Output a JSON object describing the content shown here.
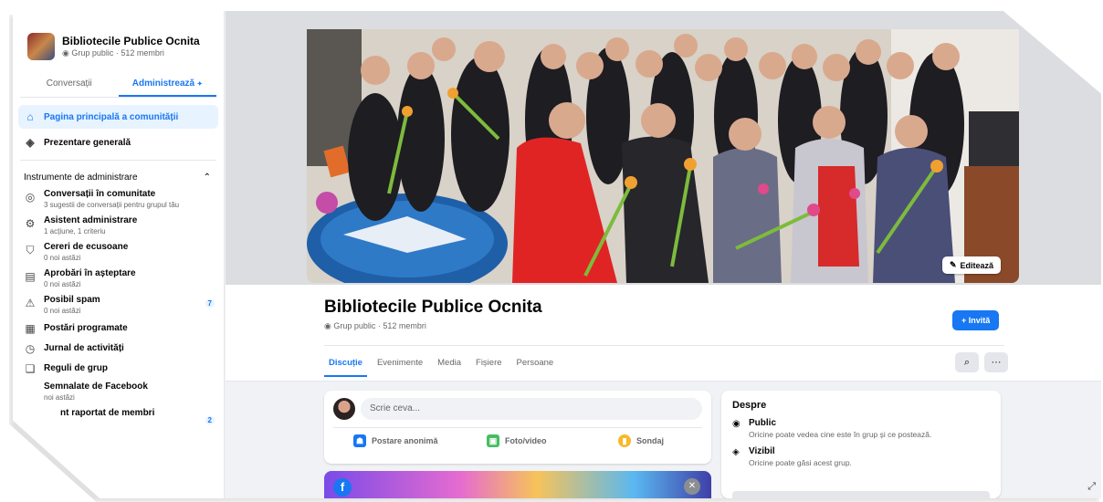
{
  "group": {
    "name": "Bibliotecile Publice Ocnita",
    "sidebar_meta": "Grup public · 512 membri",
    "meta": "Grup public · 512 membri"
  },
  "sidebar": {
    "tabs": [
      "Conversații",
      "Administrează"
    ],
    "tab_admin_suffix": "✦",
    "nav": [
      {
        "label": "Pagina principală a comunității",
        "icon": "home-icon"
      },
      {
        "label": "Prezentare generală",
        "icon": "overview-icon"
      }
    ],
    "tools_heading": "Instrumente de administrare",
    "tools": [
      {
        "title": "Conversații în comunitate",
        "sub": "3 sugestii de conversații pentru grupul tău",
        "icon": "chat-icon",
        "badge": ""
      },
      {
        "title": "Asistent administrare",
        "sub": "1 acțiune, 1 criteriu",
        "icon": "gear-icon",
        "badge": ""
      },
      {
        "title": "Cereri de ecusoane",
        "sub": "0 noi astăzi",
        "icon": "shield-icon",
        "badge": ""
      },
      {
        "title": "Aprobări în așteptare",
        "sub": "0 noi astăzi",
        "icon": "approval-icon",
        "badge": ""
      },
      {
        "title": "Posibil spam",
        "sub": "0 noi astăzi",
        "icon": "warning-icon",
        "badge": "7"
      },
      {
        "title": "Postări programate",
        "sub": "",
        "icon": "calendar-icon",
        "badge": ""
      },
      {
        "title": "Jurnal de activități",
        "sub": "",
        "icon": "clock-icon",
        "badge": ""
      },
      {
        "title": "Reguli de grup",
        "sub": "",
        "icon": "rules-icon",
        "badge": ""
      },
      {
        "title": "Semnalate de Facebook",
        "sub": "noi astăzi",
        "icon": "",
        "badge": ""
      },
      {
        "title": "nt raportat de membri",
        "sub": "",
        "icon": "",
        "badge": "2"
      }
    ]
  },
  "cover": {
    "edit_label": "Editează"
  },
  "header": {
    "invite_label": "+ Invită",
    "tabs": [
      "Discuție",
      "Evenimente",
      "Media",
      "Fișiere",
      "Persoane"
    ],
    "search_icon": "search-icon",
    "more_label": "···"
  },
  "composer": {
    "placeholder": "Scrie ceva...",
    "actions": [
      {
        "label": "Postare anonimă",
        "color": "#1877f2"
      },
      {
        "label": "Foto/video",
        "color": "#45bd62"
      },
      {
        "label": "Sondaj",
        "color": "#f7b928"
      }
    ]
  },
  "about": {
    "title": "Despre",
    "items": [
      {
        "head": "Public",
        "desc": "Oricine poate vedea cine este în grup și ce postează.",
        "icon": "globe-icon"
      },
      {
        "head": "Vizibil",
        "desc": "Oricine poate găsi acest grup.",
        "icon": "eye-icon"
      }
    ]
  },
  "colors": {
    "accent": "#1877f2",
    "background": "#f0f2f5"
  }
}
